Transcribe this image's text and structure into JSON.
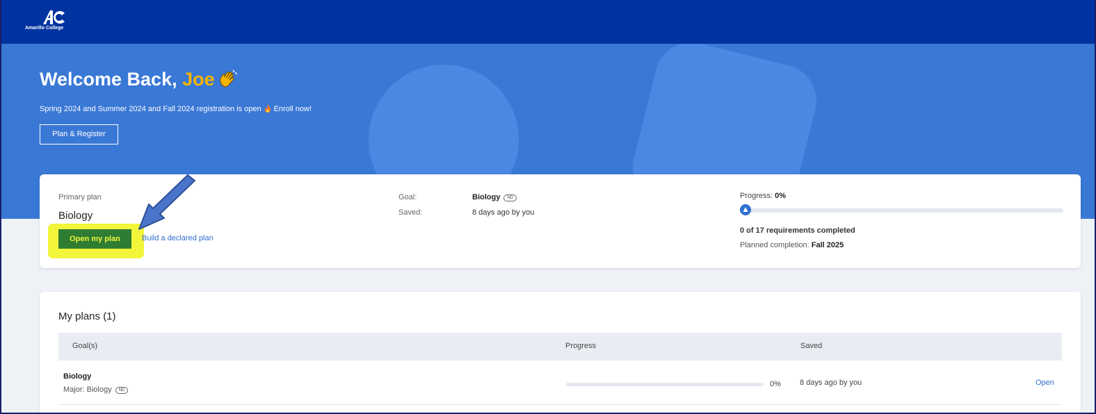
{
  "brand": {
    "name": "Amarillo College",
    "colors": {
      "topbar": "#0033a0",
      "hero": "#3a78d6",
      "accent": "#f4b400",
      "primary_button": "#2e7d32",
      "highlight": "#f2f53a",
      "link": "#2f6fd0"
    }
  },
  "hero": {
    "welcome_prefix": "Welcome Back, ",
    "user_name": "Joe",
    "wave_icon": "waving-hand-icon",
    "registration_text": "Spring 2024 and Summer 2024 and Fall 2024 registration is open",
    "fire_icon": "fire-icon",
    "enroll_text": "Enroll now!",
    "plan_register_label": "Plan & Register"
  },
  "primary_plan": {
    "label": "Primary plan",
    "title": "Biology",
    "open_button": "Open my plan",
    "build_link": "Build a declared plan",
    "goal_key": "Goal:",
    "goal_value": "Biology",
    "goal_badge": "ND",
    "saved_key": "Saved:",
    "saved_value": "8 days ago by you",
    "progress_label": "Progress: ",
    "progress_value": "0%",
    "progress_fraction": 0,
    "requirements_text": "0 of 17 requirements completed",
    "planned_label": "Planned completion: ",
    "planned_value": "Fall 2025"
  },
  "my_plans": {
    "title": "My plans (1)",
    "columns": [
      "Goal(s)",
      "Progress",
      "Saved"
    ],
    "rows": [
      {
        "goal": "Biology",
        "major": "Major: Biology",
        "badge": "ND",
        "progress_fraction": 0,
        "progress_text": "0%",
        "saved": "8 days ago by you",
        "action": "Open"
      }
    ]
  }
}
